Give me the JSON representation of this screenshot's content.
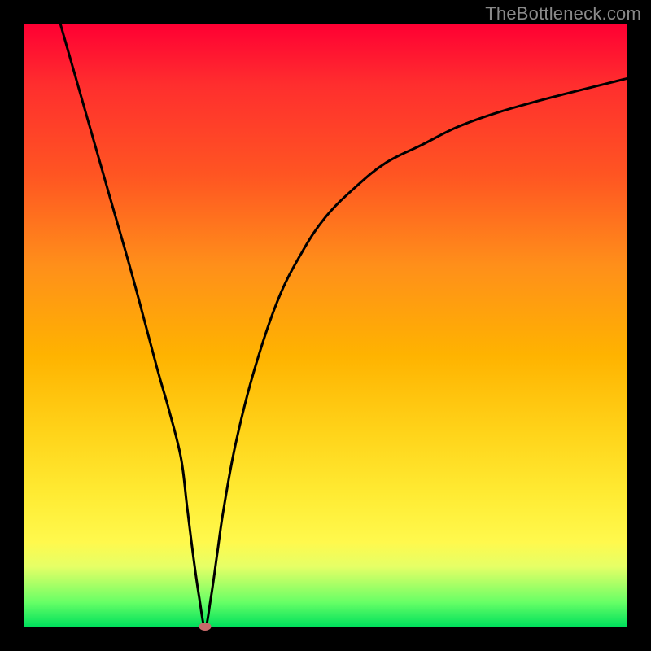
{
  "watermark": "TheBottleneck.com",
  "colors": {
    "frame": "#000000",
    "curve": "#000000",
    "marker": "#c76a6a",
    "gradient_top": "#ff0033",
    "gradient_bottom": "#00e05c"
  },
  "chart_data": {
    "type": "line",
    "title": "",
    "xlabel": "",
    "ylabel": "",
    "xlim": [
      0,
      100
    ],
    "ylim": [
      0,
      100
    ],
    "grid": false,
    "series": [
      {
        "name": "curve",
        "x": [
          6,
          10,
          14,
          18,
          22,
          24,
          26,
          27,
          28,
          29,
          30,
          31,
          32,
          33,
          35,
          38,
          42,
          46,
          50,
          55,
          60,
          66,
          72,
          79,
          88,
          100
        ],
        "values": [
          100,
          86,
          72,
          58,
          43,
          36,
          28,
          20,
          12,
          5,
          0,
          5,
          12,
          19,
          30,
          42,
          54,
          62,
          68,
          73,
          77,
          80,
          83,
          85.5,
          88,
          91
        ]
      }
    ],
    "marker": {
      "x": 30,
      "y": 0
    },
    "annotations": []
  }
}
